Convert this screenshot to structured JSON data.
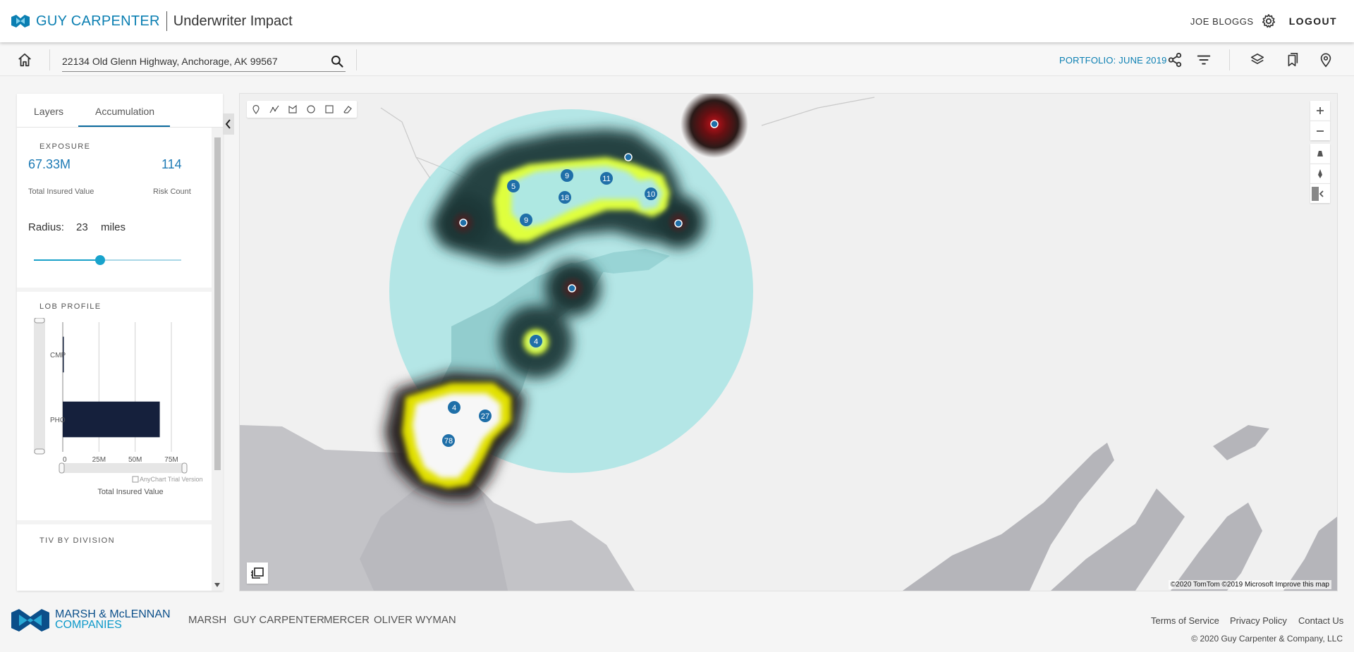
{
  "header": {
    "brand": "GUY CARPENTER",
    "app_title": "Underwriter Impact",
    "user": "JOE BLOGGS",
    "logout": "LOGOUT",
    "icons": [
      "home-icon",
      "gear-icon"
    ]
  },
  "toolbar": {
    "search_value": "22134 Old Glenn Highway, Anchorage, AK 99567",
    "portfolio": "PORTFOLIO: JUNE 2019",
    "icons": [
      "search-icon",
      "share-icon",
      "filter-icon",
      "layers-icon",
      "bookmarks-icon",
      "location-pin-icon"
    ]
  },
  "panel": {
    "tabs": [
      {
        "label": "Layers",
        "active": false
      },
      {
        "label": "Accumulation",
        "active": true
      }
    ],
    "exposure": {
      "title": "EXPOSURE",
      "tiv_value": "67.33M",
      "tiv_caption": "Total Insured Value",
      "risk_count_value": "114",
      "risk_count_caption": "Risk Count"
    },
    "radius": {
      "label": "Radius:",
      "value": "23",
      "unit": "miles",
      "slider_fraction": 0.45
    },
    "lob_profile": {
      "title": "LOB PROFILE",
      "watermark": "AnyChart Trial Version"
    },
    "tiv_by_division": {
      "title": "TIV BY DIVISION"
    }
  },
  "chart_data": {
    "type": "bar",
    "orientation": "horizontal",
    "categories": [
      "CMP",
      "PHO"
    ],
    "values": [
      0.5,
      67
    ],
    "xlabel": "Total Insured Value",
    "xticks": [
      "0",
      "25M",
      "50M",
      "75M"
    ],
    "xlim": [
      0,
      75
    ],
    "grid": true,
    "bar_color": "#15203c"
  },
  "map": {
    "draw_tools": [
      "marker-icon",
      "polyline-icon",
      "polygon-icon",
      "circle-icon",
      "rectangle-icon",
      "eraser-icon"
    ],
    "controls": [
      "zoom-in-icon",
      "zoom-out-icon",
      "tilt-icon",
      "compass-icon",
      "rotate-icon"
    ],
    "clusters": [
      {
        "label": "5"
      },
      {
        "label": "9"
      },
      {
        "label": "11"
      },
      {
        "label": "18"
      },
      {
        "label": "10"
      },
      {
        "label": "9"
      },
      {
        "label": "4"
      },
      {
        "label": "4"
      },
      {
        "label": "27"
      },
      {
        "label": "78"
      }
    ],
    "attribution": "©2020 TomTom ©2019 Microsoft",
    "attribution_link": "Improve this map",
    "colors": {
      "radius_circle": "#8fe0e0",
      "heat_low": "#1c3a3a",
      "heat_mid": "#d8ff3a",
      "heat_high": "#ffffff",
      "marker": "#1f6fa8"
    }
  },
  "footer": {
    "company": "MARSH & McLENNAN",
    "company_line2": "COMPANIES",
    "links": [
      "MARSH",
      "GUY CARPENTER",
      "MERCER",
      "OLIVER WYMAN"
    ],
    "right_links": [
      "Terms of Service",
      "Privacy Policy",
      "Contact Us"
    ],
    "copyright": "© 2020 Guy Carpenter & Company, LLC"
  }
}
